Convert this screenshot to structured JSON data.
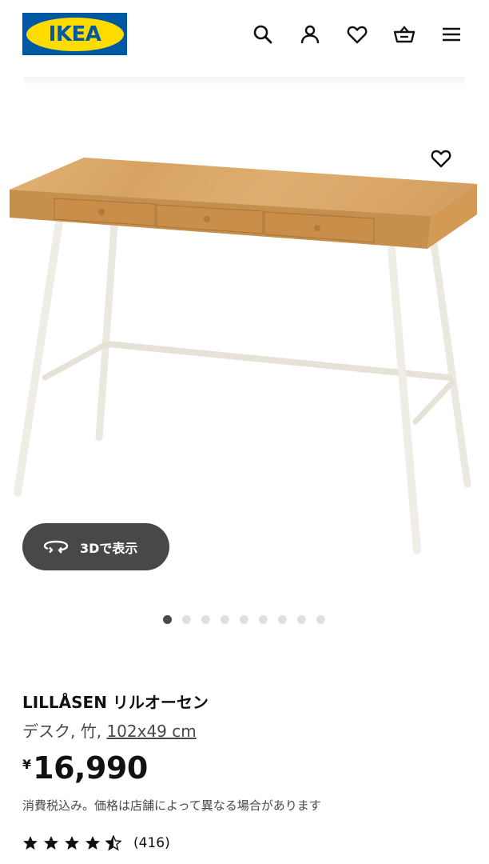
{
  "header": {
    "logo_text": "IKEA",
    "icons": [
      "search-icon",
      "account-icon",
      "favourites-icon",
      "shopping-bag-icon",
      "menu-icon"
    ]
  },
  "gallery": {
    "view_3d_label": "3Dで表示",
    "image_count": 9,
    "active_image": 1
  },
  "product": {
    "name": "LILLÅSEN リルオーセン",
    "description_prefix": "デスク, 竹, ",
    "dimensions": "102x49 cm",
    "price_currency": "¥",
    "price_amount": "16,990",
    "tax_note": "消費税込み。価格は店舗によって異なる場合があります",
    "rating_value": 4.5,
    "rating_max": 5,
    "review_count": "(416)"
  },
  "colors": {
    "ikea_blue": "#0058a3",
    "ikea_yellow": "#ffdb00",
    "button_dark": "#484848",
    "bamboo": "#d9a766"
  }
}
